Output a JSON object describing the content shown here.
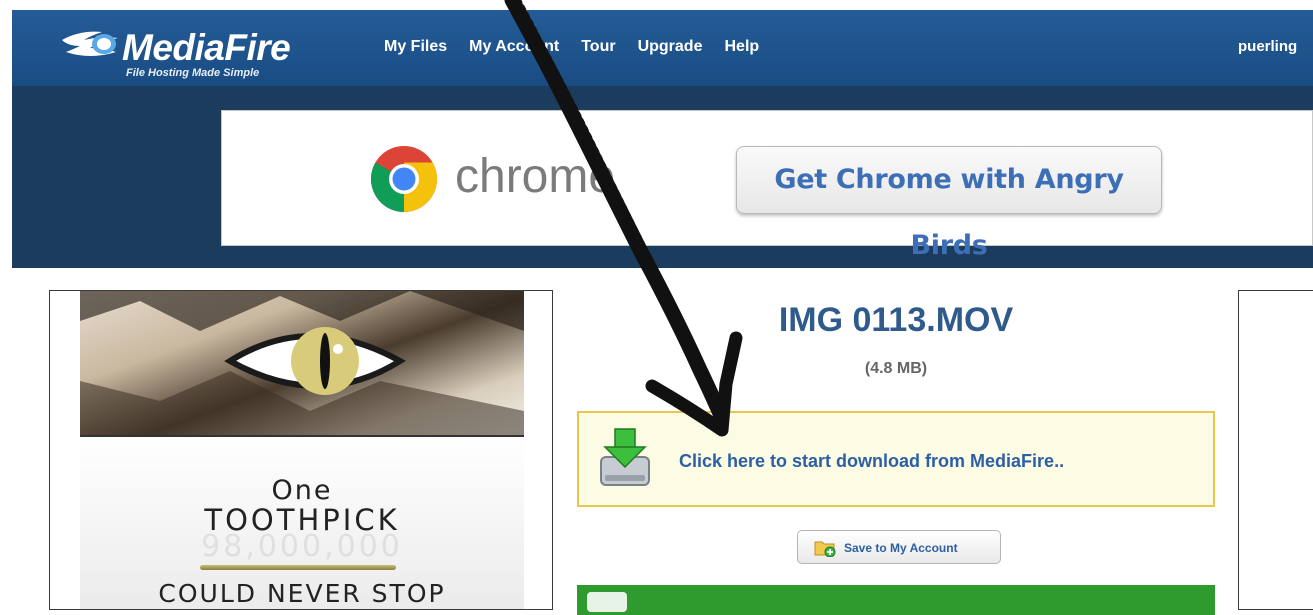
{
  "header": {
    "logo_name": "MediaFire",
    "logo_tagline": "File Hosting Made Simple",
    "nav": [
      {
        "label": "My Files"
      },
      {
        "label": "My Account"
      },
      {
        "label": "Tour"
      },
      {
        "label": "Upgrade"
      },
      {
        "label": "Help"
      }
    ],
    "user": "puerling"
  },
  "ad_banner": {
    "brand_word": "chrome",
    "button_label": "Get Chrome with Angry Birds"
  },
  "side_ad": {
    "line1": "One",
    "line2": "TOOTHPICK",
    "faded_number": "98,000,000",
    "line3": "COULD NEVER STOP"
  },
  "file": {
    "name": "IMG 0113.MOV",
    "size": "(4.8 MB)",
    "download_label": "Click here to start download from MediaFire..",
    "save_label": "Save to My Account"
  },
  "colors": {
    "header_bg": "#1f5490",
    "band_bg": "#1b3c5c",
    "link_blue": "#2c5fa3",
    "title_blue": "#2e5b8c",
    "download_box_bg": "#fcfbe4",
    "download_box_border": "#e8c84a",
    "promo_green": "#2f9b2f"
  }
}
